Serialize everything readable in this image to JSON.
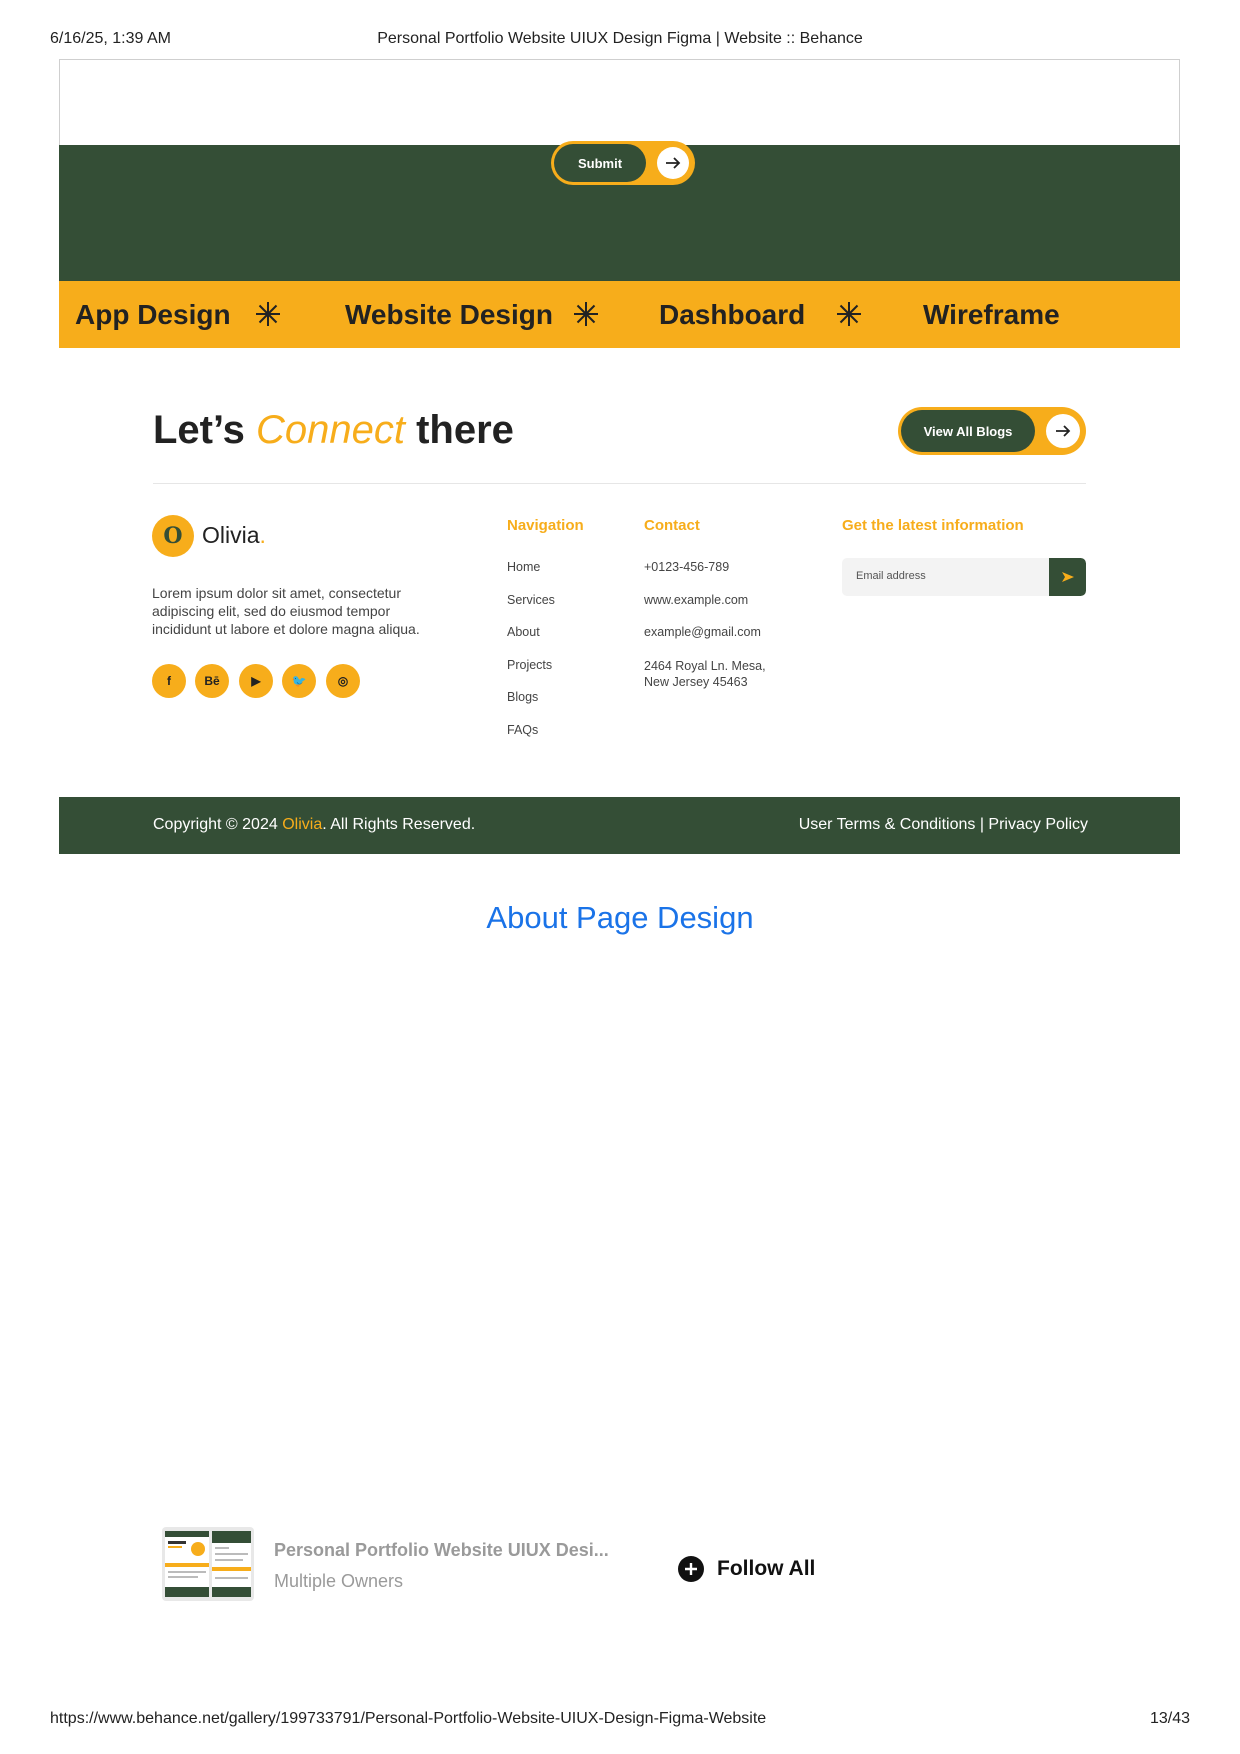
{
  "print_header": {
    "datetime": "6/16/25, 1:39 AM",
    "title": "Personal Portfolio Website UIUX Design Figma | Website :: Behance"
  },
  "print_footer": {
    "url": "https://www.behance.net/gallery/199733791/Personal-Portfolio-Website-UIUX-Design-Figma-Website",
    "page": "13/43"
  },
  "form": {
    "submit_label": "Submit"
  },
  "marquee": {
    "items": [
      "App Design",
      "Website Design",
      "Dashboard",
      "Wireframe"
    ]
  },
  "connect": {
    "prefix": "Let’s",
    "accent": "Connect",
    "suffix": "there",
    "button_label": "View All Blogs"
  },
  "brand": {
    "logo_letter": "O",
    "name": "Olivia",
    "dot": ".",
    "description": "Lorem ipsum dolor sit amet, consectetur adipiscing elit, sed do eiusmod tempor incididunt ut labore et dolore magna aliqua."
  },
  "socials": [
    {
      "icon": "facebook-icon",
      "glyph": "f"
    },
    {
      "icon": "behance-icon",
      "glyph": "Bē"
    },
    {
      "icon": "youtube-icon",
      "glyph": "▶"
    },
    {
      "icon": "twitter-icon",
      "glyph": "🐦"
    },
    {
      "icon": "instagram-icon",
      "glyph": "◎"
    }
  ],
  "navigation": {
    "heading": "Navigation",
    "items": [
      "Home",
      "Services",
      "About",
      "Projects",
      "Blogs",
      "FAQs"
    ]
  },
  "contact": {
    "heading": "Contact",
    "phone": "+0123-456-789",
    "website": "www.example.com",
    "email": "example@gmail.com",
    "address": "2464 Royal Ln. Mesa, New Jersey 45463"
  },
  "newsletter": {
    "heading": "Get the latest information",
    "placeholder": "Email address"
  },
  "copyright": {
    "prefix": "Copyright © 2024 ",
    "name": "Olivia",
    "suffix": ". All Rights Reserved.",
    "terms": "User Terms & Conditions",
    "separator": "|",
    "privacy": "Privacy Policy"
  },
  "section_title": "About Page Design",
  "project": {
    "title": "Personal Portfolio Website UIUX Desi...",
    "owner": "Multiple Owners",
    "follow_label": "Follow All"
  },
  "colors": {
    "green": "#344e36",
    "yellow": "#f7ad1b",
    "link_blue": "#1a73e8"
  }
}
